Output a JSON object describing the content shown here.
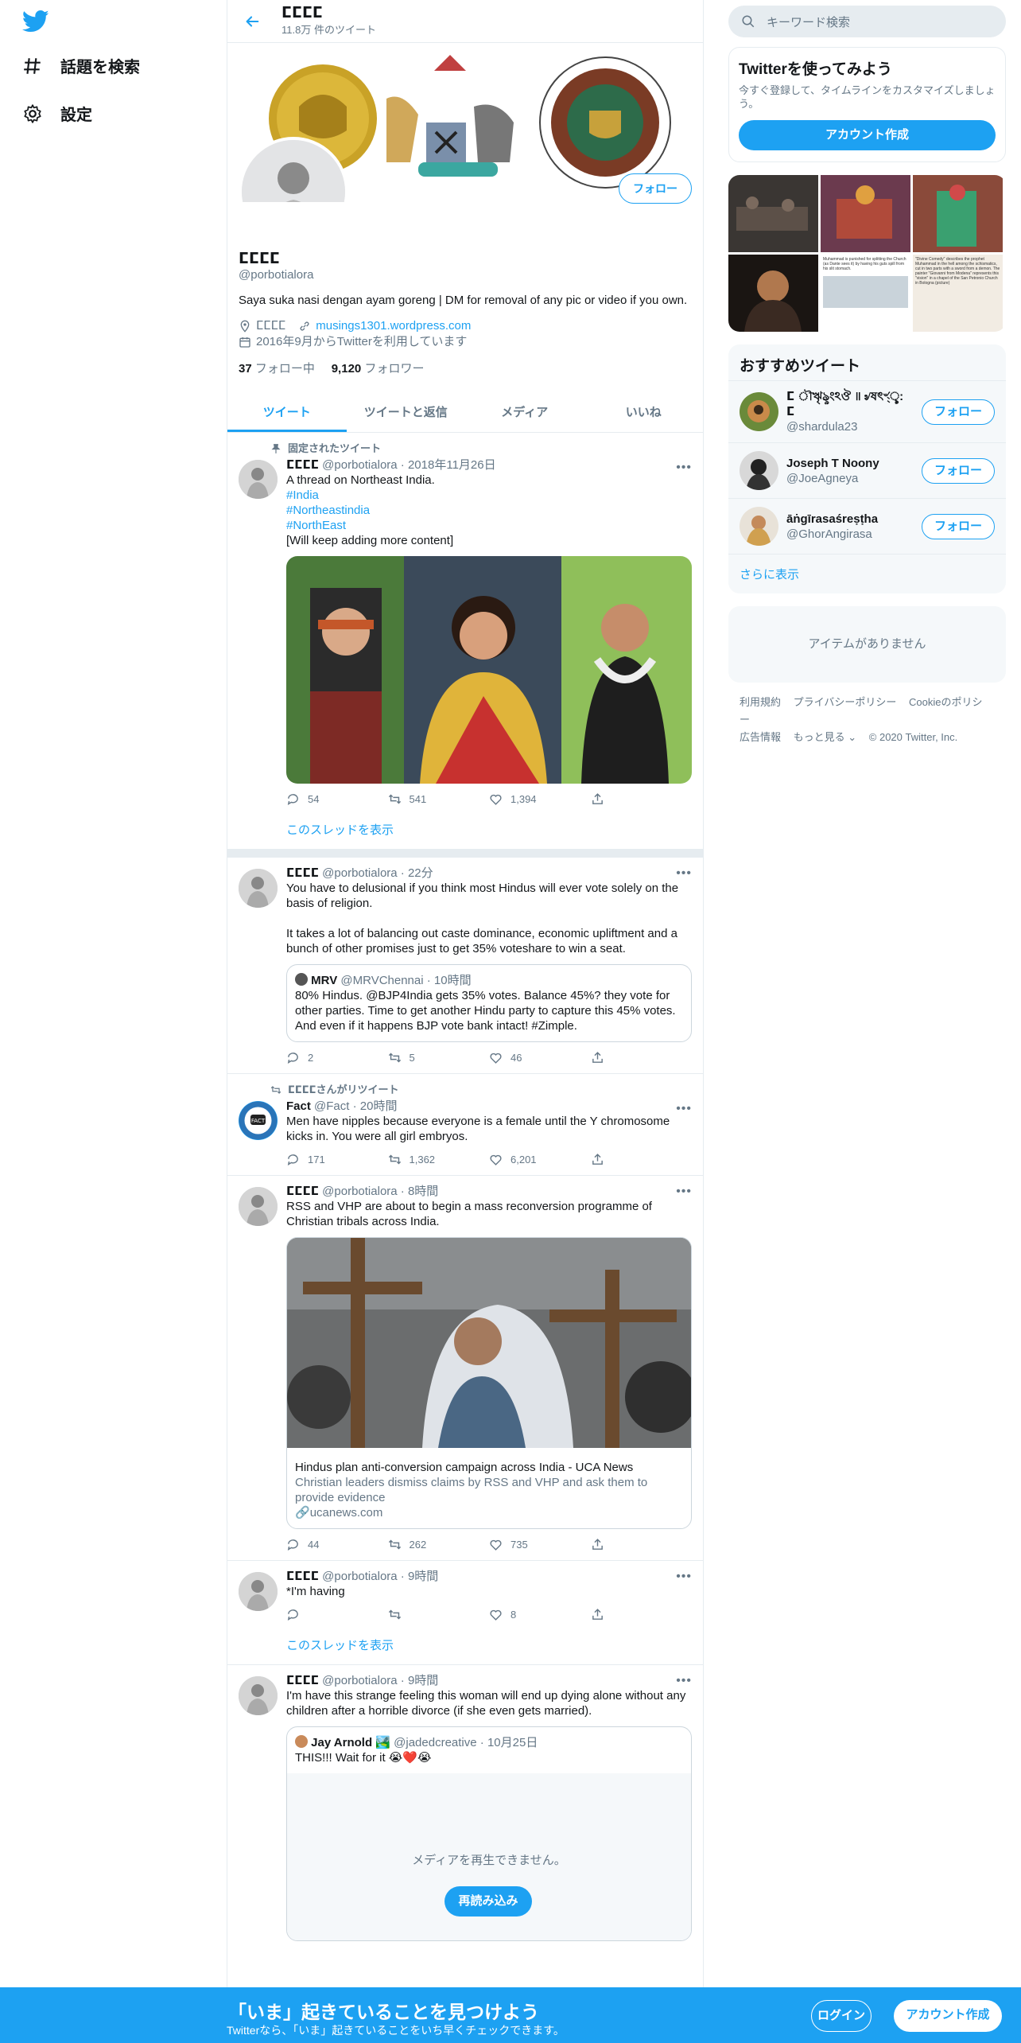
{
  "nav": {
    "explore_label": "話題を検索",
    "settings_label": "設定"
  },
  "header": {
    "title": "ⵎⵎⵎⵎ",
    "tweet_count": "11.8万 件のツイート"
  },
  "profile": {
    "name": "ⵎⵎⵎⵎ",
    "handle": "@porbotialora",
    "bio": "Saya suka nasi dengan ayam goreng | DM for removal of any pic or video if you own.",
    "location": "ⵎⵎⵎⵎ",
    "website": "musings1301.wordpress.com",
    "joined": "2016年9月からTwitterを利用しています",
    "following_count": "37",
    "following_label": "フォロー中",
    "followers_count": "9,120",
    "followers_label": "フォロワー",
    "follow_button": "フォロー"
  },
  "tabs": [
    "ツイート",
    "ツイートと返信",
    "メディア",
    "いいね"
  ],
  "tweets": {
    "pinned": {
      "context": "固定されたツイート",
      "name": "ⵎⵎⵎⵎ",
      "handle": "@porbotialora",
      "time": "2018年11月26日",
      "line1": "A thread on Northeast India.",
      "tag1": "#India",
      "tag2": "#Northeastindia",
      "tag3": "#NorthEast",
      "line2": "[Will keep adding more content]",
      "replies": "54",
      "retweets": "541",
      "likes": "1,394",
      "thread_link": "このスレッドを表示"
    },
    "t2": {
      "name": "ⵎⵎⵎⵎ",
      "handle": "@porbotialora",
      "time": "22分",
      "para1": "You have to delusional if you think most Hindus will ever vote solely on the basis of religion.",
      "para2": "It takes a lot of balancing out caste dominance, economic upliftment and a bunch of other promises just to get 35% voteshare to win a seat.",
      "quote_name": "MRV",
      "quote_handle": "@MRVChennai",
      "quote_time": "10時間",
      "quote_text": "80% Hindus. @BJP4India gets 35% votes. Balance 45%? they vote for other parties. Time to get another Hindu party to capture this 45% votes. And even if it happens BJP vote bank intact! #Zimple.",
      "replies": "2",
      "retweets": "5",
      "likes": "46"
    },
    "t3": {
      "context": "ⵎⵎⵎⵎさんがリツイート",
      "name": "Fact",
      "handle": "@Fact",
      "time": "20時間",
      "text": "Men have nipples because everyone is a female until the Y chromosome kicks in. You were all girl embryos.",
      "replies": "171",
      "retweets": "1,362",
      "likes": "6,201"
    },
    "t4": {
      "name": "ⵎⵎⵎⵎ",
      "handle": "@porbotialora",
      "time": "8時間",
      "text": "RSS and VHP are about to begin a mass reconversion programme of Christian tribals across India.",
      "card_title": "Hindus plan anti-conversion campaign across India - UCA News",
      "card_desc": "Christian leaders dismiss claims by RSS and VHP and ask them to provide evidence",
      "card_domain": "ucanews.com",
      "replies": "44",
      "retweets": "262",
      "likes": "735"
    },
    "t5": {
      "name": "ⵎⵎⵎⵎ",
      "handle": "@porbotialora",
      "time": "9時間",
      "text": "*I'm having",
      "likes": "8",
      "thread_link": "このスレッドを表示"
    },
    "t6": {
      "name": "ⵎⵎⵎⵎ",
      "handle": "@porbotialora",
      "time": "9時間",
      "text": "I'm have this strange feeling this woman will end up dying alone without any children after a horrible divorce (if she even gets married).",
      "quote_name": "Jay Arnold 🏞️",
      "quote_handle": "@jadedcreative",
      "quote_time": "10月25日",
      "quote_text": "THIS!!! Wait for it 😭❤️😭",
      "media_error": "メディアを再生できません。",
      "reload_button": "再読み込み"
    }
  },
  "sidebar": {
    "search_placeholder": "キーワード検索",
    "signup_title": "Twitterを使ってみよう",
    "signup_text": "今すぐ登録して、タイムラインをカスタマイズしましょう。",
    "signup_button": "アカウント作成",
    "media_captions": {
      "c1": "Muhammad is punished for splitting the Church (as Dante sees it) by having his guts spill from his slit stomach.",
      "c2": "\"Divine Comedy\" describes the prophet Muhammad in the hell among the schismatics, cut in two parts with a sword from a demon. The painter \"Giovanni from Modena\" represents this \"vision\" in a chapel of the San Petronio Church in Bologna (picture)"
    },
    "rec_title": "おすすめツイート",
    "recs": [
      {
        "name": "ⵎ ৗৠৡংঽঔ ॥ ৶ষৎৼ্ৢ: ⵎ",
        "handle": "@shardula23",
        "button": "フォロー"
      },
      {
        "name": "Joseph T Noony",
        "handle": "@JoeAgneya",
        "button": "フォロー"
      },
      {
        "name": "āṅgīrasaśreṣṭha",
        "handle": "@GhorAngirasa",
        "button": "フォロー"
      }
    ],
    "rec_more": "さらに表示",
    "empty_text": "アイテムがありません",
    "footer": [
      "利用規約",
      "プライバシーポリシー",
      "Cookieのポリシー",
      "広告情報",
      "もっと見る ⌄",
      "© 2020 Twitter, Inc."
    ]
  },
  "bottom_bar": {
    "title": "「いま」起きていることを見つけよう",
    "subtitle": "Twitterなら、「いま」起きていることをいち早くチェックできます。",
    "login": "ログイン",
    "signup": "アカウント作成"
  }
}
